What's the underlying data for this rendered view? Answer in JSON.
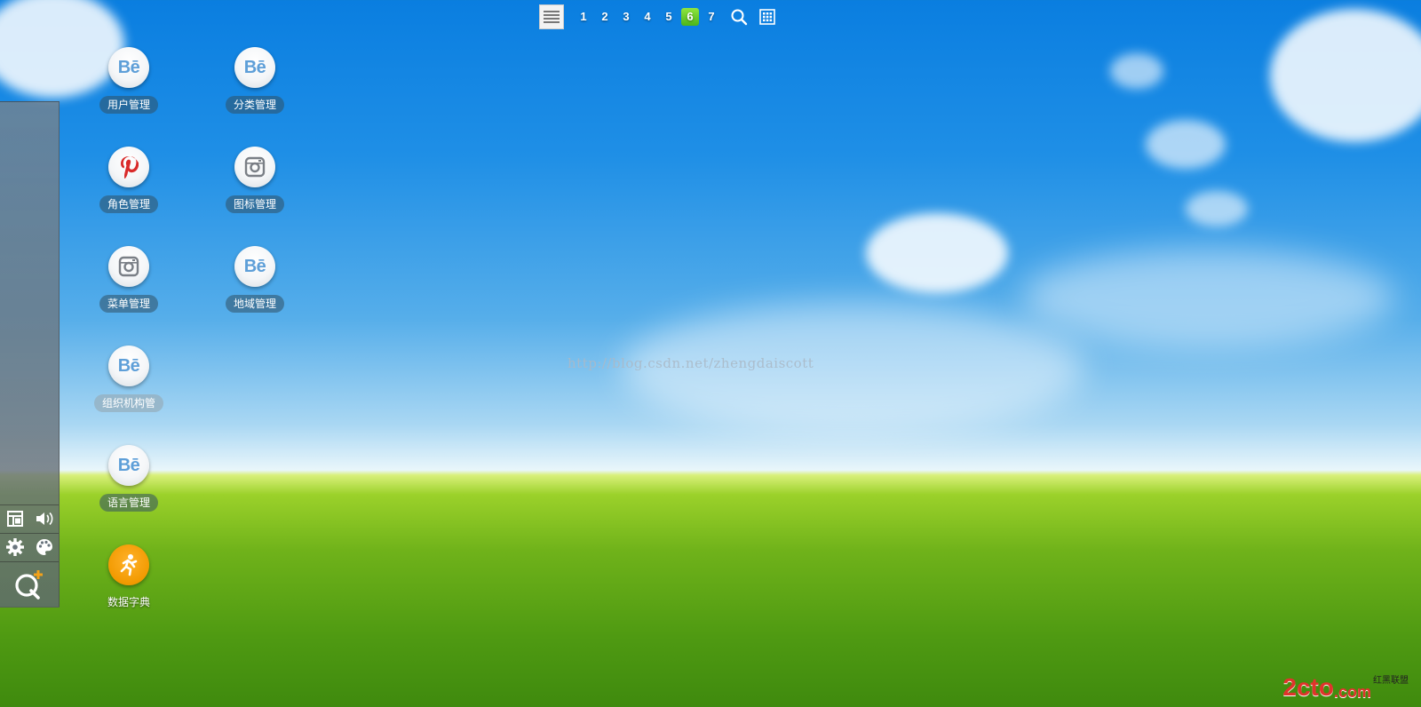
{
  "topbar": {
    "pages": [
      "1",
      "2",
      "3",
      "4",
      "5",
      "6",
      "7"
    ],
    "active_page": "6",
    "logo_icon": "app-logo-icon",
    "search_icon": "search-icon",
    "grid_icon": "grid-icon"
  },
  "apps": [
    {
      "name": "app-user-management",
      "label": "用户管理",
      "icon": "behance-icon"
    },
    {
      "name": "app-category-management",
      "label": "分类管理",
      "icon": "behance-icon"
    },
    {
      "name": "app-role-management",
      "label": "角色管理",
      "icon": "pinterest-icon"
    },
    {
      "name": "app-icon-management",
      "label": "图标管理",
      "icon": "instagram-icon"
    },
    {
      "name": "app-menu-management",
      "label": "菜单管理",
      "icon": "instagram-icon"
    },
    {
      "name": "app-region-management",
      "label": "地域管理",
      "icon": "behance-icon"
    },
    {
      "name": "app-org-management",
      "label": "组织机构管",
      "icon": "behance-icon"
    },
    {
      "name": "app-language-management",
      "label": "语言管理",
      "icon": "behance-icon"
    },
    {
      "name": "app-data-dictionary",
      "label": "数据字典",
      "icon": "runner-icon"
    }
  ],
  "dock": {
    "buttons": [
      "layout-icon",
      "volume-icon",
      "gear-icon",
      "palette-icon",
      "qplus-icon"
    ]
  },
  "watermark": "http://blog.csdn.net/zhengdaiscott",
  "corner_logo": {
    "brand": "2cto",
    "suffix": ".com",
    "sub": "红黑联盟"
  },
  "colors": {
    "active_page": "#5cc21f",
    "label_bg": "#325064",
    "sky_top": "#0a7ee0",
    "grass": "#4f9a12"
  }
}
